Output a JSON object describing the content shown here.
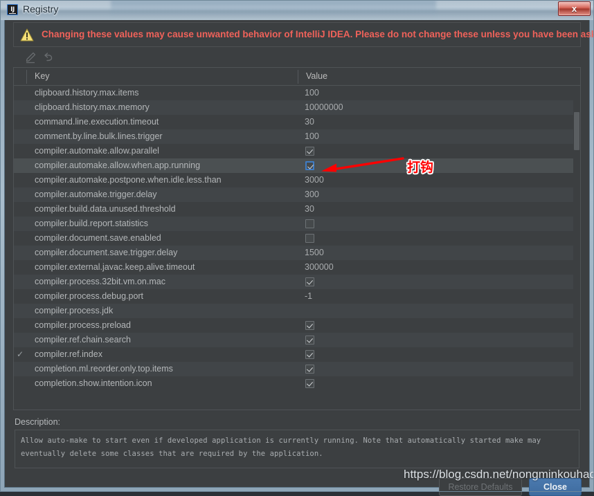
{
  "window": {
    "title": "Registry",
    "app_icon": "intellij-idea-icon",
    "close_label": "x"
  },
  "warning": {
    "icon": "warning-triangle-icon",
    "text": "Changing these values may cause unwanted behavior of IntelliJ IDEA. Please do not change these unless you have been asked.",
    "color": "#f0625a"
  },
  "toolbar": {
    "buttons": [
      {
        "name": "edit-icon",
        "tooltip": "Edit"
      },
      {
        "name": "revert-icon",
        "tooltip": "Revert"
      }
    ]
  },
  "table": {
    "columns": [
      "Key",
      "Value"
    ],
    "rows": [
      {
        "gutter": "",
        "key": "clipboard.history.max.items",
        "type": "text",
        "value": "100"
      },
      {
        "gutter": "",
        "key": "clipboard.history.max.memory",
        "type": "text",
        "value": "10000000"
      },
      {
        "gutter": "",
        "key": "command.line.execution.timeout",
        "type": "text",
        "value": "30"
      },
      {
        "gutter": "",
        "key": "comment.by.line.bulk.lines.trigger",
        "type": "text",
        "value": "100"
      },
      {
        "gutter": "",
        "key": "compiler.automake.allow.parallel",
        "type": "checkbox",
        "value": "checked"
      },
      {
        "gutter": "",
        "key": "compiler.automake.allow.when.app.running",
        "type": "checkbox",
        "value": "checked",
        "selected": true,
        "focused": true
      },
      {
        "gutter": "",
        "key": "compiler.automake.postpone.when.idle.less.than",
        "type": "text",
        "value": "3000"
      },
      {
        "gutter": "",
        "key": "compiler.automake.trigger.delay",
        "type": "text",
        "value": "300"
      },
      {
        "gutter": "",
        "key": "compiler.build.data.unused.threshold",
        "type": "text",
        "value": "30"
      },
      {
        "gutter": "",
        "key": "compiler.build.report.statistics",
        "type": "checkbox",
        "value": "unchecked"
      },
      {
        "gutter": "",
        "key": "compiler.document.save.enabled",
        "type": "checkbox",
        "value": "unchecked"
      },
      {
        "gutter": "",
        "key": "compiler.document.save.trigger.delay",
        "type": "text",
        "value": "1500"
      },
      {
        "gutter": "",
        "key": "compiler.external.javac.keep.alive.timeout",
        "type": "text",
        "value": "300000"
      },
      {
        "gutter": "",
        "key": "compiler.process.32bit.vm.on.mac",
        "type": "checkbox",
        "value": "checked"
      },
      {
        "gutter": "",
        "key": "compiler.process.debug.port",
        "type": "text",
        "value": "-1"
      },
      {
        "gutter": "",
        "key": "compiler.process.jdk",
        "type": "text",
        "value": ""
      },
      {
        "gutter": "",
        "key": "compiler.process.preload",
        "type": "checkbox",
        "value": "checked"
      },
      {
        "gutter": "",
        "key": "compiler.ref.chain.search",
        "type": "checkbox",
        "value": "checked"
      },
      {
        "gutter": "✓",
        "key": "compiler.ref.index",
        "type": "checkbox",
        "value": "checked"
      },
      {
        "gutter": "",
        "key": "completion.ml.reorder.only.top.items",
        "type": "checkbox",
        "value": "checked"
      },
      {
        "gutter": "",
        "key": "completion.show.intention.icon",
        "type": "checkbox",
        "value": "checked"
      }
    ]
  },
  "description": {
    "label": "Description:",
    "text": "Allow auto-make to start even if developed application is currently running. Note that automatically started make may eventually delete some classes that are required by the application."
  },
  "footer": {
    "restore_defaults_label": "Restore Defaults",
    "close_label": "Close"
  },
  "annotation": {
    "text": "打钩",
    "color": "#ff0000"
  },
  "watermark": {
    "text": "https://blog.csdn.net/nongminkouhao"
  }
}
